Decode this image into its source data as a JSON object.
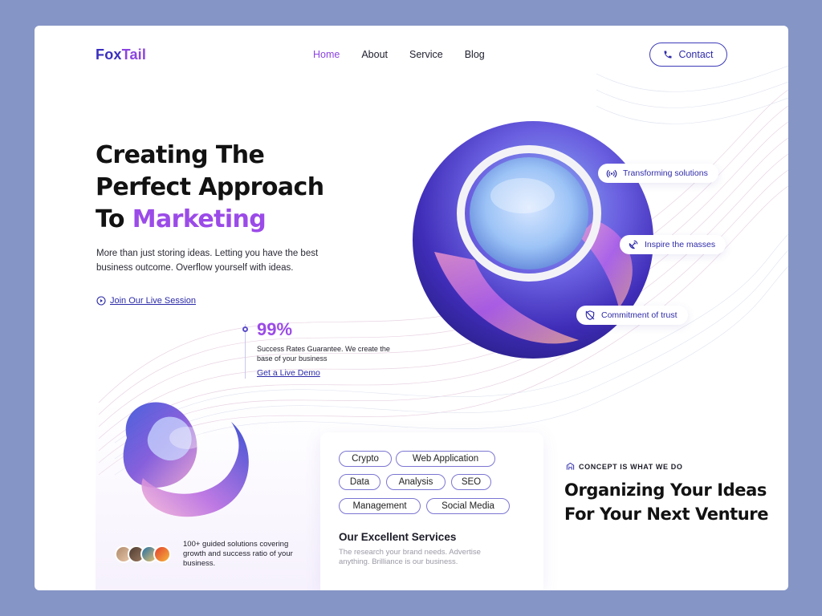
{
  "brand": {
    "logo_part1": "Fox",
    "logo_part2": "Tail"
  },
  "nav": {
    "items": [
      "Home",
      "About",
      "Service",
      "Blog"
    ],
    "active": "Home"
  },
  "header": {
    "contact_label": "Contact"
  },
  "hero": {
    "line1": "Creating The",
    "line2": "Perfect Approach",
    "line3_prefix": "To ",
    "line3_highlight": "Marketing",
    "lede": "More than just storing ideas. Letting you have the best business outcome. Overflow yourself with ideas.",
    "join_link": "Join Our Live Session"
  },
  "stat": {
    "value": "99%",
    "text": "Success Rates Guarantee. We create the base of your business",
    "link": "Get a Live Demo"
  },
  "features": [
    {
      "label": "Transforming solutions",
      "icon": "signal-icon"
    },
    {
      "label": "Inspire the masses",
      "icon": "satellite-dish-icon"
    },
    {
      "label": "Commitment of trust",
      "icon": "shield-off-icon"
    }
  ],
  "social_proof": {
    "text": "100+ guided solutions covering growth and success ratio of your business."
  },
  "services": {
    "tags": [
      "Crypto",
      "Web Application",
      "Data",
      "Analysis",
      "SEO",
      "Management",
      "Social Media"
    ],
    "title": "Our Excellent Services",
    "desc": "The research your brand needs. Advertise anything. Brilliance is our business."
  },
  "concept": {
    "eyebrow": "CONCEPT IS WHAT WE DO",
    "heading": "Organizing Your Ideas For Your Next Venture"
  },
  "colors": {
    "background": "#8595c6",
    "brand_dark": "#3b2fbf",
    "brand_purple": "#8b44e0",
    "link": "#2b2aa8"
  }
}
